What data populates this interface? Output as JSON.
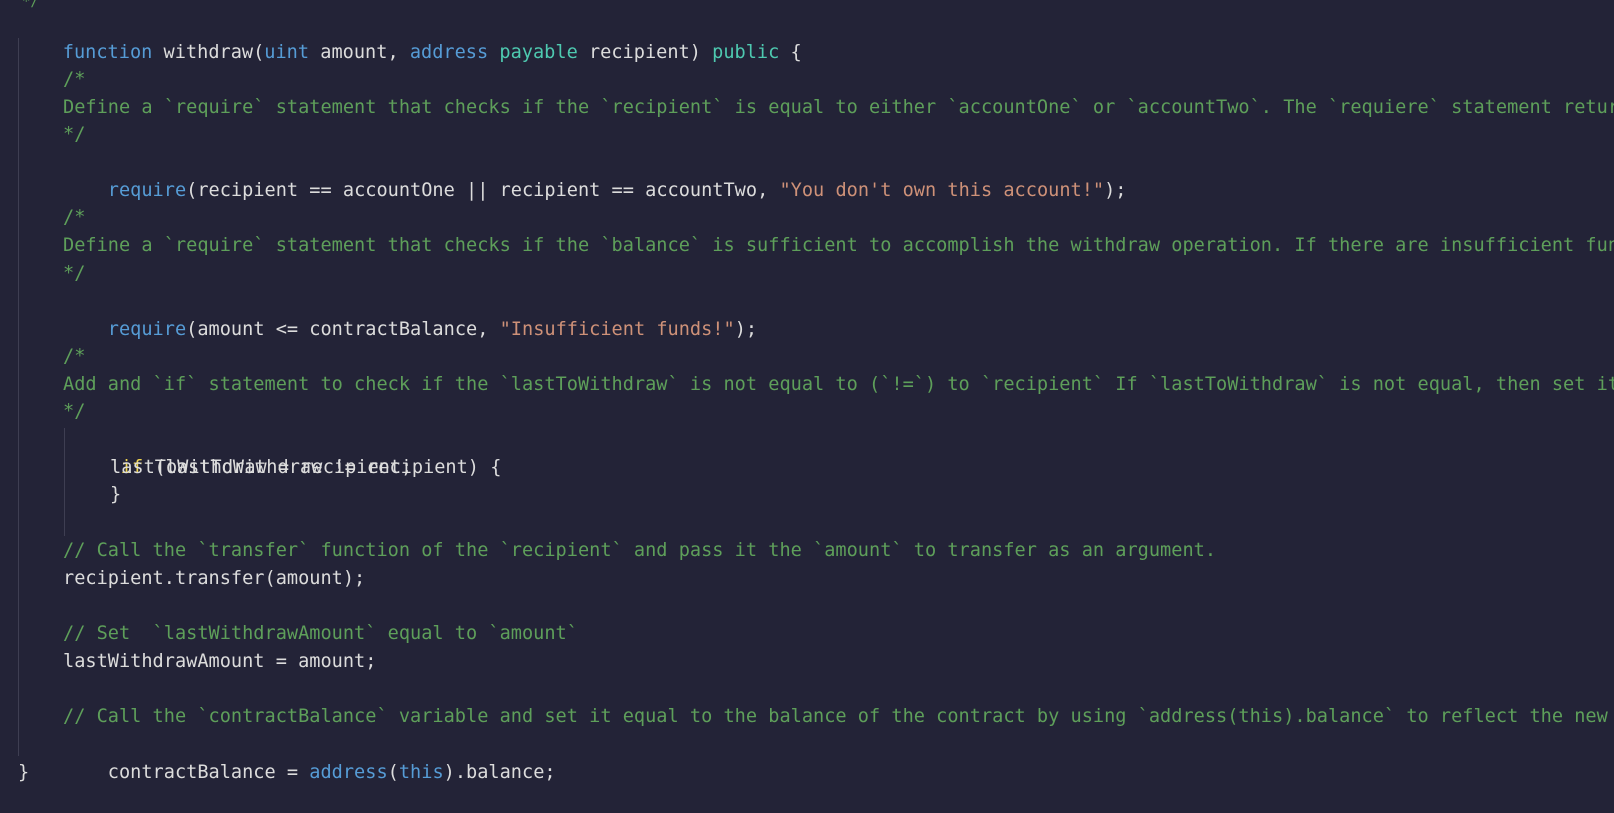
{
  "code": {
    "top_fragment": "*/",
    "l1": {
      "kw_function": "function",
      "name": " withdraw(",
      "kw_uint": "uint",
      "p1": " amount, ",
      "kw_address": "address",
      "sp1": " ",
      "kw_payable": "payable",
      "p2": " recipient) ",
      "kw_public": "public",
      "brace": " {"
    },
    "c1_open": "/*",
    "c1_text": "Define a `require` statement that checks if the `recipient` is equal to either `accountOne` or `accountTwo`. The `requiere` statement returns the text `\"You don't own this account!\"` if it does not.",
    "c1_close": "*/",
    "r1": {
      "fn": "require",
      "args": "(recipient == accountOne || recipient == accountTwo, ",
      "str": "\"You don't own this account!\"",
      "end": ");"
    },
    "c2_open": "/*",
    "c2_text": "Define a `require` statement that checks if the `balance` is sufficient to accomplish the withdraw operation. If there are insufficient funds, the text `Insufficient funds!` is returned.",
    "c2_close": "*/",
    "r2": {
      "fn": "require",
      "args": "(amount <= contractBalance, ",
      "str": "\"Insufficient funds!\"",
      "end": ");"
    },
    "c3_open": "/*",
    "c3_text": "Add and `if` statement to check if the `lastToWithdraw` is not equal to (`!=`) to `recipient` If `lastToWithdraw` is not equal, then set it to the current value of `recipient`.",
    "c3_close": "*/",
    "if_line": {
      "kw": "if",
      "rest": " (lastToWithdraw != recipient) {"
    },
    "assign_line": "lastToWithdraw = recipient;",
    "if_close": "}",
    "c4": "// Call the `transfer` function of the `recipient` and pass it the `amount` to transfer as an argument.",
    "transfer_line": "recipient.transfer(amount);",
    "c5": "// Set  `lastWithdrawAmount` equal to `amount`",
    "lwa_line": "lastWithdrawAmount = amount;",
    "c6": "// Call the `contractBalance` variable and set it equal to the balance of the contract by using `address(this).balance` to reflect the new balance of the contract.",
    "cb_line": {
      "pre": "contractBalance = ",
      "kw_address": "address",
      "paren": "(",
      "kw_this": "this",
      "post": ").balance;"
    },
    "fn_close": "}"
  },
  "colors": {
    "background": "#232337",
    "keyword": "#569cd6",
    "type_modifier": "#4ec9b0",
    "control": "#f0d44f",
    "comment": "#5e9f5a",
    "string": "#ce9178",
    "text": "#dcdcdc"
  }
}
